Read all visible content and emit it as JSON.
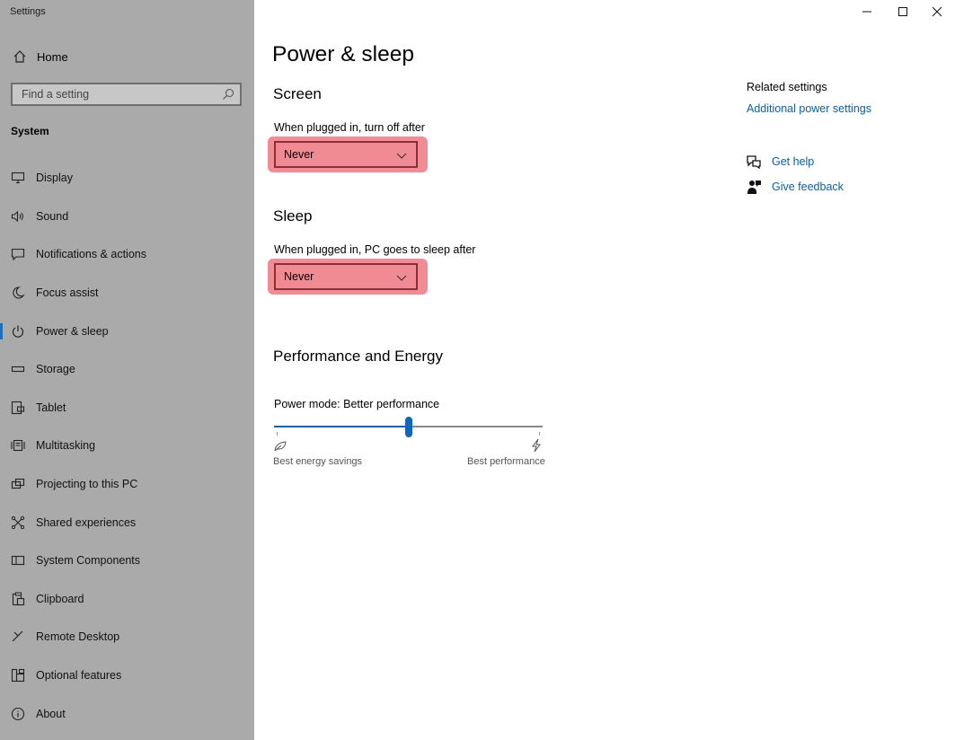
{
  "window": {
    "title": "Settings",
    "controls": {
      "minimize": "minimize",
      "maximize": "maximize",
      "close": "close"
    }
  },
  "sidebar": {
    "home_label": "Home",
    "search_placeholder": "Find a setting",
    "section_label": "System",
    "items": [
      {
        "label": "Display",
        "icon": "display-icon"
      },
      {
        "label": "Sound",
        "icon": "sound-icon"
      },
      {
        "label": "Notifications & actions",
        "icon": "notifications-icon"
      },
      {
        "label": "Focus assist",
        "icon": "moon-icon"
      },
      {
        "label": "Power & sleep",
        "icon": "power-icon",
        "active": true
      },
      {
        "label": "Storage",
        "icon": "storage-icon"
      },
      {
        "label": "Tablet",
        "icon": "tablet-icon"
      },
      {
        "label": "Multitasking",
        "icon": "multitasking-icon"
      },
      {
        "label": "Projecting to this PC",
        "icon": "projecting-icon"
      },
      {
        "label": "Shared experiences",
        "icon": "shared-icon"
      },
      {
        "label": "System Components",
        "icon": "components-icon"
      },
      {
        "label": "Clipboard",
        "icon": "clipboard-icon"
      },
      {
        "label": "Remote Desktop",
        "icon": "remote-desktop-icon"
      },
      {
        "label": "Optional features",
        "icon": "optional-features-icon"
      },
      {
        "label": "About",
        "icon": "info-icon"
      }
    ]
  },
  "main": {
    "title": "Power & sleep",
    "screen": {
      "heading": "Screen",
      "label": "When plugged in, turn off after",
      "value": "Never"
    },
    "sleep": {
      "heading": "Sleep",
      "label": "When plugged in, PC goes to sleep after",
      "value": "Never"
    },
    "performance": {
      "heading": "Performance and Energy",
      "mode_label": "Power mode: Better performance",
      "slider_level": 0.5,
      "min_caption": "Best energy savings",
      "max_caption": "Best performance"
    }
  },
  "related": {
    "heading": "Related settings",
    "additional_link": "Additional power settings",
    "get_help": "Get help",
    "give_feedback": "Give feedback"
  },
  "colors": {
    "sidebar_bg": "#aaaaaa",
    "accent": "#0a68c2",
    "highlight": "#f07f8a",
    "link": "#0a5fb4"
  }
}
